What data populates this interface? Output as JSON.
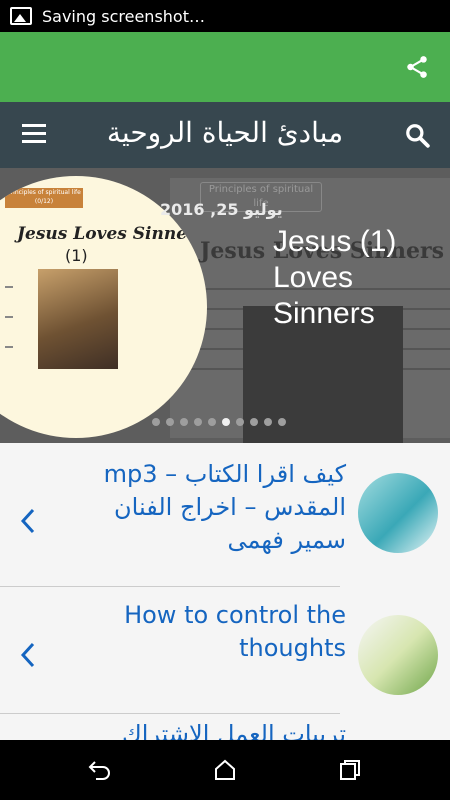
{
  "status_bar": {
    "text": "Saving screenshot…"
  },
  "app_bar": {
    "title": "مبادئ الحياة الروحية"
  },
  "slider": {
    "date": "يوليو 25, 2016",
    "title": "Jesus (1) Loves Sinners",
    "image_caption": "Jesus Loves Sinners",
    "image_subcaption": "(1)",
    "image_header": "Principles of spiritual life (0/12)",
    "background_caption": "Principles of spiritual life",
    "background_title": "Jesus Loves Sinners",
    "active_dot": 5,
    "dot_count": 10
  },
  "list": {
    "items": [
      {
        "title": "mp3 – كيف اقرا الكتاب المقدس – اخراج الفنان سمير فهمى"
      },
      {
        "title": "How to control the thoughts"
      },
      {
        "title": "تربيات العمل الاشتراك"
      }
    ]
  },
  "colors": {
    "green_bar": "#4caf50",
    "app_bar": "#37474f",
    "link": "#1565c0"
  },
  "icons": [
    "image-icon",
    "share-icon",
    "menu-icon",
    "search-icon",
    "chevron-left-icon",
    "back-icon",
    "home-icon",
    "recents-icon"
  ]
}
